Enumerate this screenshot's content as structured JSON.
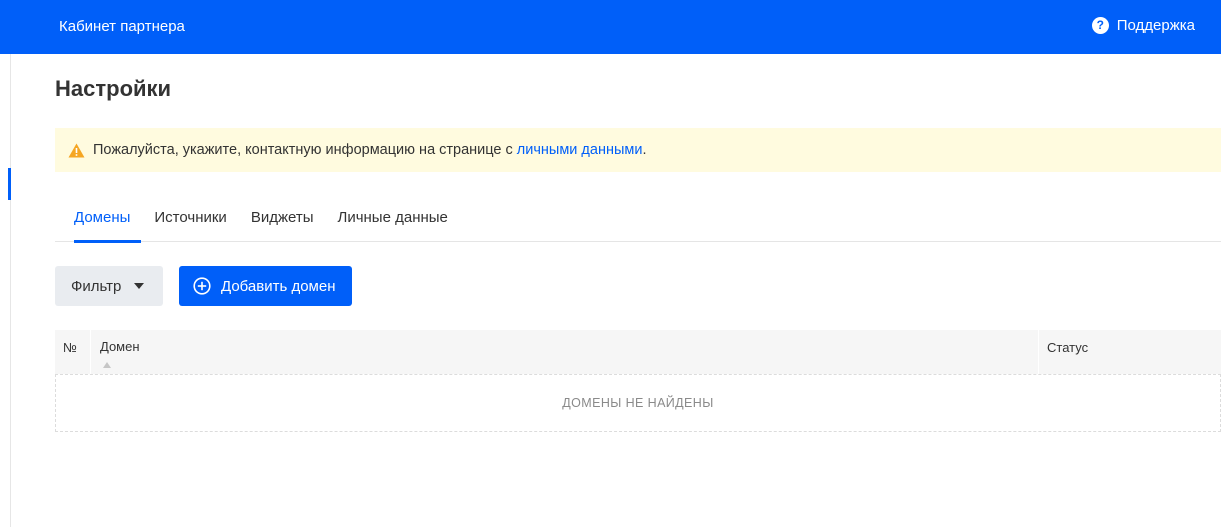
{
  "header": {
    "brand": "Кабинет партнера",
    "support_label": "Поддержка",
    "support_icon": "help-circle-icon",
    "accent_color": "#005ff9"
  },
  "page": {
    "title": "Настройки"
  },
  "notice": {
    "icon": "warning-icon",
    "text": "Пожалуйста, укажите, контактную информацию на странице с",
    "link_text": "личными данными",
    "trailing": "."
  },
  "tabs": [
    {
      "label": "Домены",
      "active": true
    },
    {
      "label": "Источники",
      "active": false
    },
    {
      "label": "Виджеты",
      "active": false
    },
    {
      "label": "Личные данные",
      "active": false
    }
  ],
  "toolbar": {
    "filter_label": "Фильтр",
    "add_label": "Добавить домен"
  },
  "table": {
    "columns": [
      "№",
      "Домен",
      "Статус"
    ],
    "empty_message": "ДОМЕНЫ НЕ НАЙДЕНЫ"
  }
}
